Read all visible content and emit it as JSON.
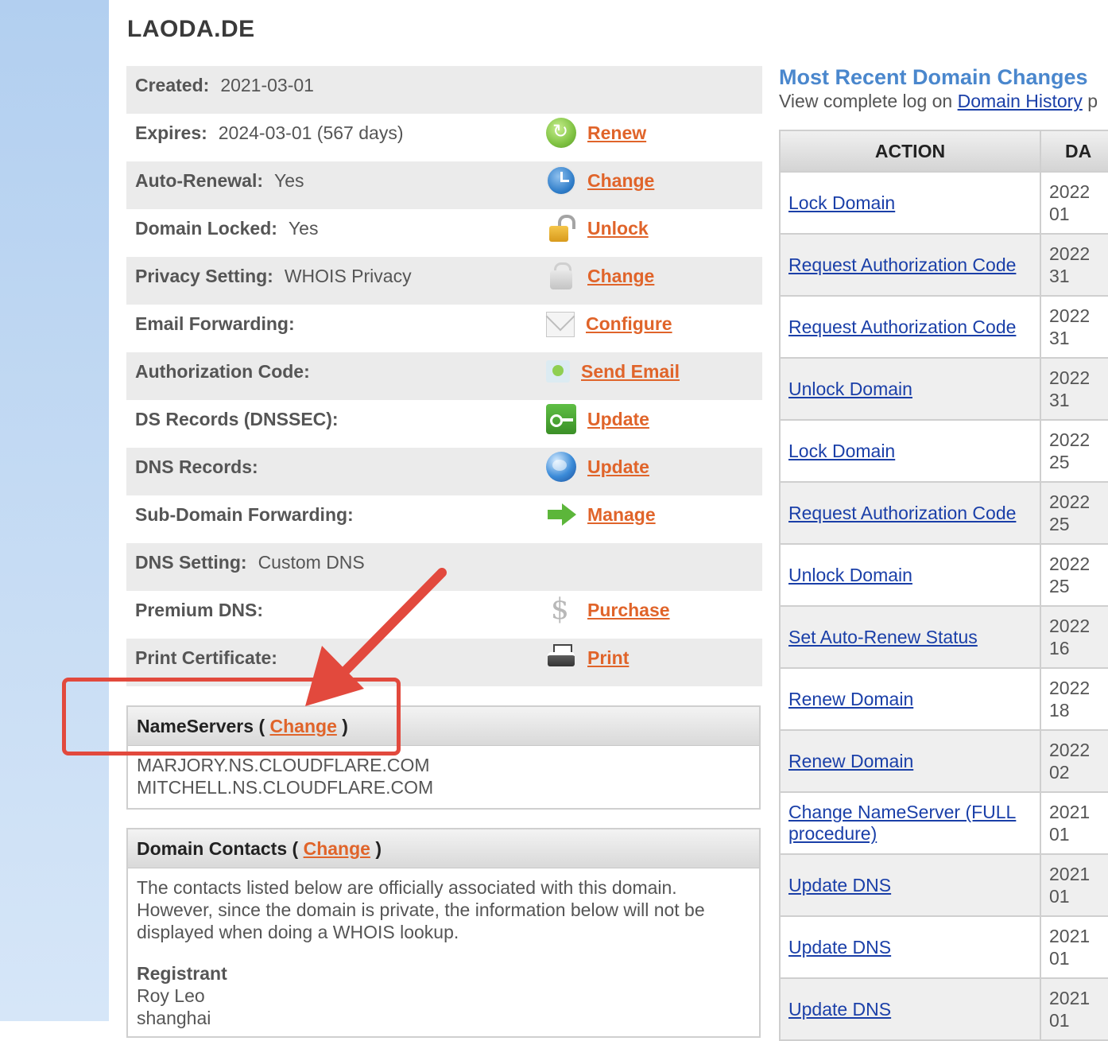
{
  "domain": {
    "title": "LAODA.DE"
  },
  "info_rows": [
    {
      "label": "Created:",
      "value": "2021-03-01",
      "action": null,
      "icon": null
    },
    {
      "label": "Expires:",
      "value": "2024-03-01 (567 days)",
      "action": "Renew",
      "icon": "renew-icon"
    },
    {
      "label": "Auto-Renewal:",
      "value": "Yes",
      "action": "Change",
      "icon": "clock-icon"
    },
    {
      "label": "Domain Locked:",
      "value": "Yes",
      "action": "Unlock",
      "icon": "lock-icon"
    },
    {
      "label": "Privacy Setting:",
      "value": "WHOIS Privacy",
      "action": "Change",
      "icon": "privacy-lock-icon"
    },
    {
      "label": "Email Forwarding:",
      "value": "",
      "action": "Configure",
      "icon": "envelope-icon"
    },
    {
      "label": "Authorization Code:",
      "value": "",
      "action": "Send Email",
      "icon": "auth-email-icon"
    },
    {
      "label": "DS Records (DNSSEC):",
      "value": "",
      "action": "Update",
      "icon": "key-icon"
    },
    {
      "label": "DNS Records:",
      "value": "",
      "action": "Update",
      "icon": "globe-icon"
    },
    {
      "label": "Sub-Domain Forwarding:",
      "value": "",
      "action": "Manage",
      "icon": "arrow-right-icon"
    },
    {
      "label": "DNS Setting:",
      "value": "Custom DNS",
      "action": null,
      "icon": null
    },
    {
      "label": "Premium DNS:",
      "value": "",
      "action": "Purchase",
      "icon": "dollar-icon"
    },
    {
      "label": "Print Certificate:",
      "value": "",
      "action": "Print",
      "icon": "printer-icon"
    }
  ],
  "nameservers": {
    "heading": "NameServers",
    "open": "(",
    "close": ")",
    "change_label": "Change",
    "servers": [
      "MARJORY.NS.CLOUDFLARE.COM",
      "MITCHELL.NS.CLOUDFLARE.COM"
    ]
  },
  "contacts": {
    "heading": "Domain Contacts",
    "open": "(",
    "close": ")",
    "change_label": "Change",
    "notice": "The contacts listed below are officially associated with this domain. However, since the domain is private, the information below will not be displayed when doing a WHOIS lookup.",
    "registrant_heading": "Registrant",
    "registrant_lines": [
      "Roy Leo",
      "shanghai"
    ]
  },
  "recent_changes": {
    "title": "Most Recent Domain Changes",
    "subtitle_prefix": "View complete log on",
    "history_link": "Domain History",
    "subtitle_suffix": "p",
    "col_action": "ACTION",
    "col_date": "DA",
    "rows": [
      {
        "action": "Lock Domain",
        "date": [
          "2022",
          "01"
        ]
      },
      {
        "action": "Request Authorization Code",
        "date": [
          "2022",
          "31"
        ]
      },
      {
        "action": "Request Authorization Code",
        "date": [
          "2022",
          "31"
        ]
      },
      {
        "action": "Unlock Domain",
        "date": [
          "2022",
          "31"
        ]
      },
      {
        "action": "Lock Domain",
        "date": [
          "2022",
          "25"
        ]
      },
      {
        "action": "Request Authorization Code",
        "date": [
          "2022",
          "25"
        ]
      },
      {
        "action": "Unlock Domain",
        "date": [
          "2022",
          "25"
        ]
      },
      {
        "action": "Set Auto-Renew Status",
        "date": [
          "2022",
          "16"
        ]
      },
      {
        "action": "Renew Domain",
        "date": [
          "2022",
          "18"
        ]
      },
      {
        "action": "Renew Domain",
        "date": [
          "2022",
          "02"
        ]
      },
      {
        "action": "Change NameServer (FULL procedure)",
        "date": [
          "2021",
          "01"
        ]
      },
      {
        "action": "Update DNS",
        "date": [
          "2021",
          "01"
        ]
      },
      {
        "action": "Update DNS",
        "date": [
          "2021",
          "01"
        ]
      },
      {
        "action": "Update DNS",
        "date": [
          "2021",
          "01"
        ]
      }
    ]
  },
  "colors": {
    "action_link": "#e0642a",
    "blue_link": "#1a3fa8",
    "section_title": "#4a87cd",
    "annotation": "#e2493d",
    "sidebar": "#b2cff0"
  }
}
